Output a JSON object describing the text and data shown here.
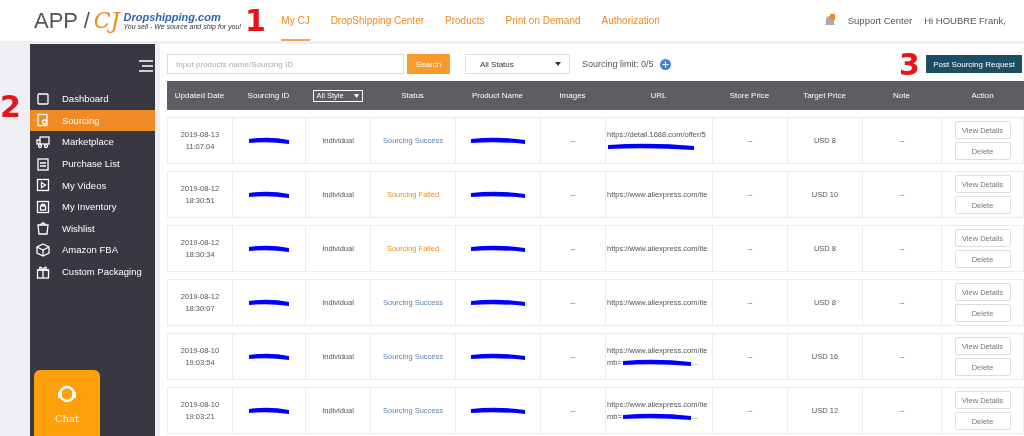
{
  "header": {
    "logo": {
      "app": "APP /",
      "mark": "CJ",
      "site": "Dropshipping.com",
      "tagline": "You sell - We source and ship for you!"
    },
    "nav": [
      {
        "label": "My CJ",
        "selected": true
      },
      {
        "label": "DropShipping Center",
        "selected": false
      },
      {
        "label": "Products",
        "selected": false
      },
      {
        "label": "Print on Demand",
        "selected": false
      },
      {
        "label": "Authorization",
        "selected": false
      }
    ],
    "support": "Support Center",
    "greeting": "Hi HOUBRE Frank,"
  },
  "annotations": [
    "1",
    "2",
    "3"
  ],
  "sidebar": {
    "items": [
      {
        "label": "Dashboard",
        "selected": false
      },
      {
        "label": "Sourcing",
        "selected": true
      },
      {
        "label": "Marketplace",
        "selected": false
      },
      {
        "label": "Purchase List",
        "selected": false
      },
      {
        "label": "My Videos",
        "selected": false
      },
      {
        "label": "My Inventory",
        "selected": false
      },
      {
        "label": "Wishlist",
        "selected": false
      },
      {
        "label": "Amazon FBA",
        "selected": false
      },
      {
        "label": "Custom Packaging",
        "selected": false
      }
    ],
    "chat": "Chat"
  },
  "toolbar": {
    "search": {
      "placeholder": "Input products name/Sourcing ID"
    },
    "search_button": "Search",
    "status_filter": "All Status",
    "limit": "Sourcing limit: 0/5",
    "post_button": "Post Sourcing Request"
  },
  "table": {
    "columns": [
      "Updated Date",
      "Sourcing ID",
      "All Style",
      "Status",
      "Product Name",
      "Images",
      "URL",
      "Store Price",
      "Target Price",
      "Note",
      "Action"
    ],
    "rows": [
      {
        "date": "2019-08-13",
        "time": "11:07:04",
        "style": "Individual",
        "status": {
          "text": "Sourcing Success",
          "kind": "success"
        },
        "images": "--",
        "url": [
          "https://detail.1688.com/offer/5"
        ],
        "store_price": "--",
        "target_price": "USD 8",
        "note": "--",
        "actions": [
          "View Details",
          "Delete"
        ]
      },
      {
        "date": "2019-08-12",
        "time": "18:30:51",
        "style": "Individual",
        "status": {
          "text": "Sourcing Failed",
          "kind": "failed"
        },
        "images": "--",
        "url": [
          "https://www.aliexpress.com/ite"
        ],
        "store_price": "--",
        "target_price": "USD 10",
        "note": "--",
        "actions": [
          "View Details",
          "Delete"
        ]
      },
      {
        "date": "2019-08-12",
        "time": "18:30:34",
        "style": "Individual",
        "status": {
          "text": "Sourcing Failed",
          "kind": "failed"
        },
        "images": "--",
        "url": [
          "https://www.aliexpress.com/ite"
        ],
        "store_price": "--",
        "target_price": "USD 8",
        "note": "--",
        "actions": [
          "View Details",
          "Delete"
        ]
      },
      {
        "date": "2019-08-12",
        "time": "18:30:07",
        "style": "Individual",
        "status": {
          "text": "Sourcing Success",
          "kind": "success"
        },
        "images": "--",
        "url": [
          "https://www.aliexpress.com/ite"
        ],
        "store_price": "--",
        "target_price": "USD 8",
        "note": "--",
        "actions": [
          "View Details",
          "Delete"
        ]
      },
      {
        "date": "2019-08-10",
        "time": "19:03:54",
        "style": "Individual",
        "status": {
          "text": "Sourcing Success",
          "kind": "success"
        },
        "images": "--",
        "url": [
          "https://www.aliexpress.com/ite",
          "mb=",
          "..."
        ],
        "store_price": "--",
        "target_price": "USD 16",
        "note": "--",
        "actions": [
          "View Details",
          "Delete"
        ]
      },
      {
        "date": "2019-08-10",
        "time": "19:03:21",
        "style": "Individual",
        "status": {
          "text": "Sourcing Success",
          "kind": "success"
        },
        "images": "--",
        "url": [
          "https://www.aliexpress.com/ite",
          "mb=",
          "..."
        ],
        "store_price": "--",
        "target_price": "USD 12",
        "note": "--",
        "actions": [
          "View Details",
          "Delete"
        ]
      }
    ]
  }
}
